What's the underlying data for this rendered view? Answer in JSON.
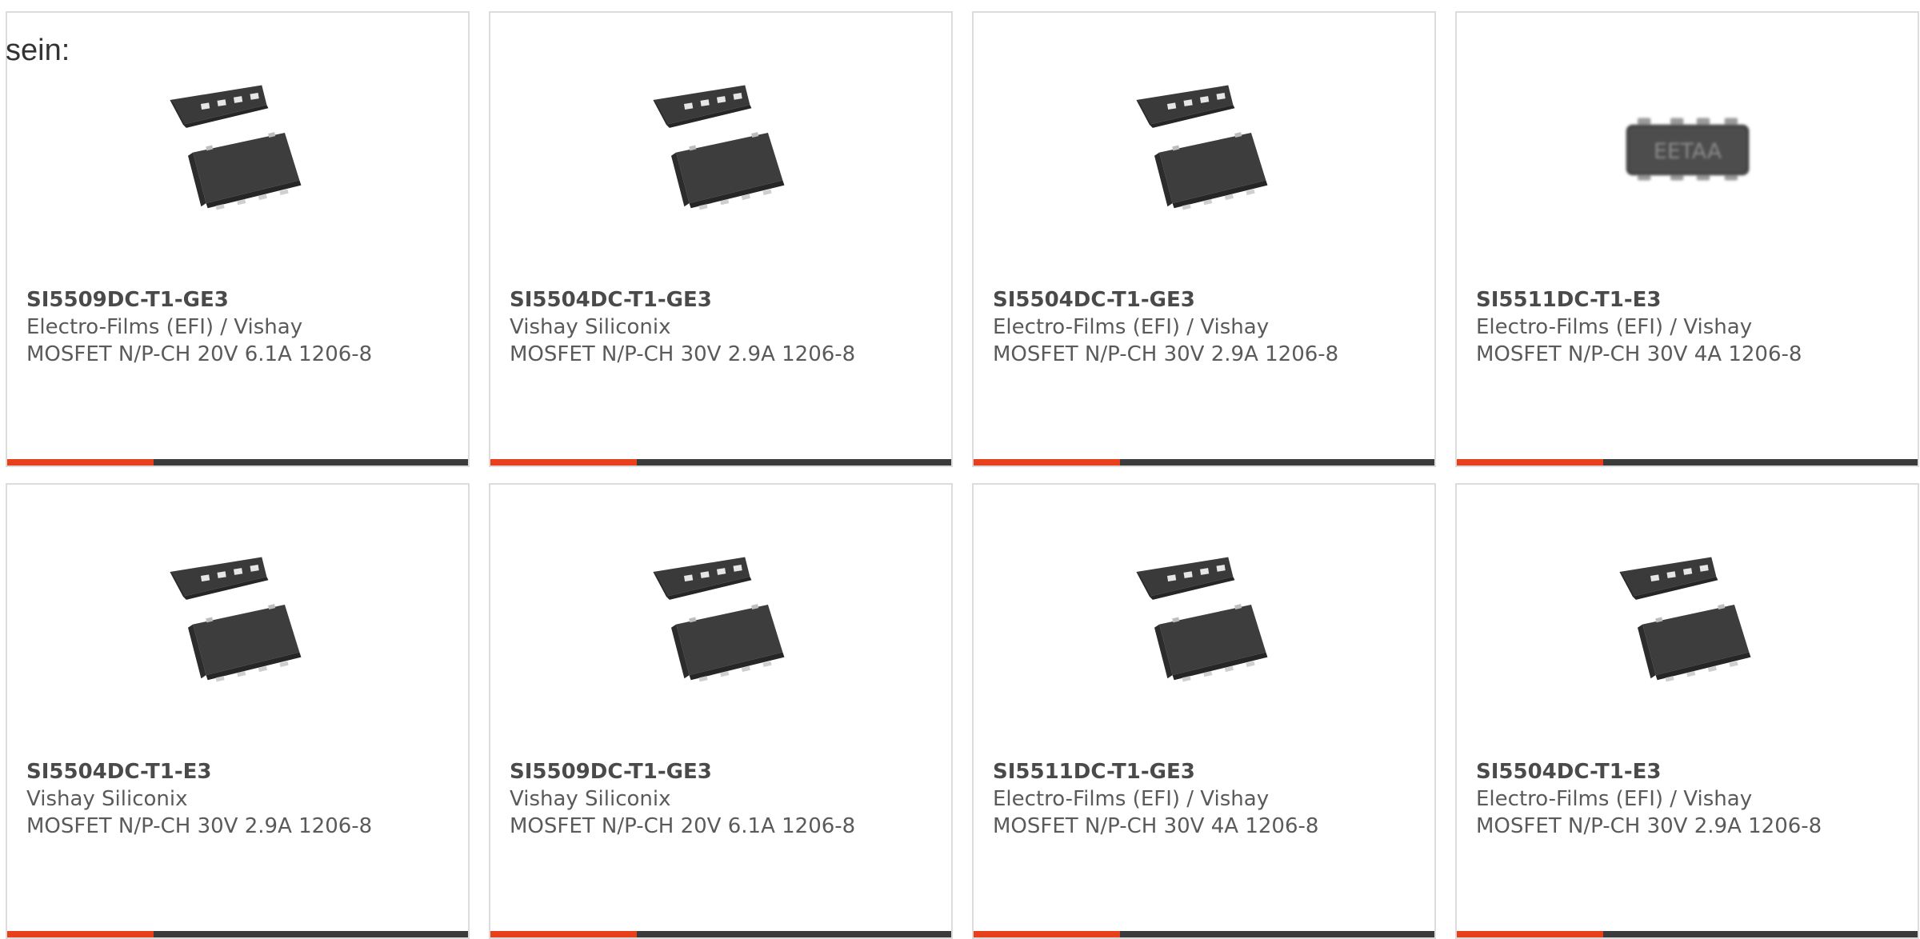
{
  "intro_text": "sein:",
  "accent_color": "#e8401c",
  "bar_color": "#3b3b3b",
  "products": [
    {
      "part_number": "SI5509DC-T1-GE3",
      "manufacturer": "Electro-Films (EFI) / Vishay",
      "description": "MOSFET N/P-CH 20V 6.1A 1206-8",
      "image": "chipfet-8-package",
      "marking": ""
    },
    {
      "part_number": "SI5504DC-T1-GE3",
      "manufacturer": "Vishay Siliconix",
      "description": "MOSFET N/P-CH 30V 2.9A 1206-8",
      "image": "chipfet-8-package",
      "marking": ""
    },
    {
      "part_number": "SI5504DC-T1-GE3",
      "manufacturer": "Electro-Films (EFI) / Vishay",
      "description": "MOSFET N/P-CH 30V 2.9A 1206-8",
      "image": "chipfet-8-package",
      "marking": ""
    },
    {
      "part_number": "SI5511DC-T1-E3",
      "manufacturer": "Electro-Films (EFI) / Vishay",
      "description": "MOSFET N/P-CH 30V 4A 1206-8",
      "image": "chip-top-view",
      "marking": "EETAA"
    },
    {
      "part_number": "SI5504DC-T1-E3",
      "manufacturer": "Vishay Siliconix",
      "description": "MOSFET N/P-CH 30V 2.9A 1206-8",
      "image": "chipfet-8-package",
      "marking": ""
    },
    {
      "part_number": "SI5509DC-T1-GE3",
      "manufacturer": "Vishay Siliconix",
      "description": "MOSFET N/P-CH 20V 6.1A 1206-8",
      "image": "chipfet-8-package",
      "marking": ""
    },
    {
      "part_number": "SI5511DC-T1-GE3",
      "manufacturer": "Electro-Films (EFI) / Vishay",
      "description": "MOSFET N/P-CH 30V 4A 1206-8",
      "image": "chipfet-8-package",
      "marking": ""
    },
    {
      "part_number": "SI5504DC-T1-E3",
      "manufacturer": "Electro-Films (EFI) / Vishay",
      "description": "MOSFET N/P-CH 30V 2.9A 1206-8",
      "image": "chipfet-8-package",
      "marking": ""
    }
  ]
}
